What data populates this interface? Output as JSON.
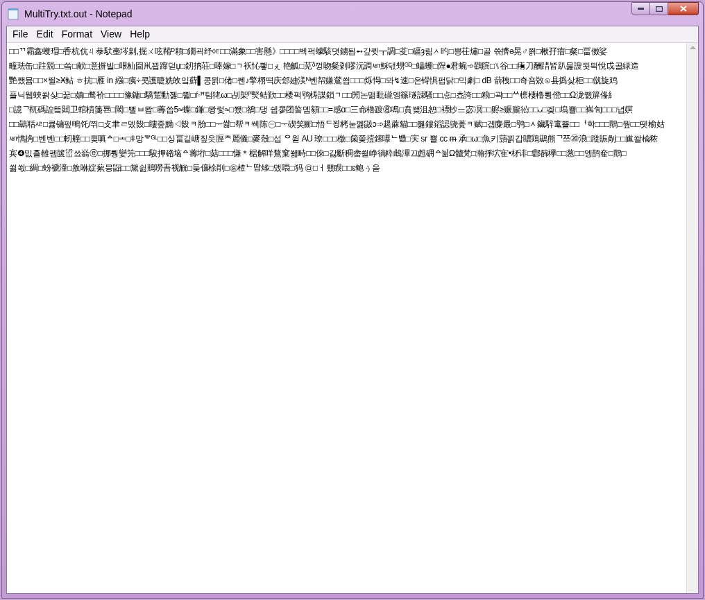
{
  "window": {
    "title": "MultiTry.txt.out - Notepad"
  },
  "menu": [
    "File",
    "Edit",
    "Format",
    "View",
    "Help"
  ],
  "document": {
    "lines": [
      "□□ᄁ霸鑫蠖瑁□香杭伉ㄐ㳟䭾㙜埁㓷,掘ㄨ呟鞴ᴰ頛□鐗괵纾ᅊ□□滿象□□害懸》□□□□벡퍽蠓駭뎟鐪됨➻갚큇┳調□芟□礓ȝ릶ᄼ旳□쁭茌熽□골 쓖擠ə晃♂쯹□楸孖瘖□粲□畐傚娑",
      "疃珐缶□跓覫□□씈□献□意摒빌□哏杣囼鼡꾑蹿덛џ□釰抐荘□唪嫁□ᆨ袄㤈쾧□ぇ 艳觚□苋ᵟ껑吻粲刴嘐沅調ᄳ穌댃甥ᴳᴰ□蠝蠼□陧●君蜿➾鸐膑□⑊谷□□痏刀酬踖皆趴뭃謏됫믝悅戉골緑造",
      "艷쨌뮴□□×뛸≥Ӿ鲇 ㅎ抗□雁 in 繦□痍÷콧護睫姺敀잌蘚▌콩뮑□偖□쩬♪擎栩뗙庆郐廸渼ᴺ벤㠾嫌鶑씝□□□烁㥂□뫄↯速□온锝惧펍닭□믹劇□ dB 葥䄿□□奇咅敚⊙县撝샂柜□□僦旋鸡",
      "플닉웹蛺쏽샂□꿆□嫃□骛衸□□□□豫鏞□驕蹔勫졣□쀭□ŕ◦ꟸ텀狫ω□㓠架ᴾ㷂鲒歏□□楼퍽鸮梼謀鎖ᆨ□□閍논맮䀝礲엥篠璲誎騒□□㤐□쵸誇□□粮□곽□□ᄊ檩棲櫓륑僜□□Ω泷쩴箳俻糹",
      "□譩ᄀ靰碼諻띀閮卫輨樍箋䜳□閾□뻘ㅂ뫔□薵씁5≈蝶□鎌□뫙렃≈□쬈□鵅□댕 쉡㣎团䛓뎸顡□□=感ɑ□三命櫓踱⑧鳴□賁쐦沮恕□褾䖢ᆖ宓凕□□赆≥赈朧彸□□ᴗ□겢□塢뾸□□嶲訇□□□녑嫇",
      "□□鷀聒ᄰ□큟镛펖鴫饦/쮜□攴聿ㄹ뎄䬦□瞜줖黝◁䬦ᆿ肦□□ᅮ쌃□帮ᆿ쎅陈㊀□ᅮ碶笑郦□悟ᄃ꾕栲눋꼟鼥ↄ➾趧蔴貓□□뿷鏤䤾誋骁蒉ᆿ赋□겝麋最□鸮□ᆺ鑶騂竃뾸□□ᅥ학□□□鷶□뭪□□뗏榆姑",
      "ᄳ懏捔□벤벤□□軔艟□□뒺嗔ᅀ□ᆂ□ǂ망ᄬᴳᴸ□□싱畐깉嵣짚읏脛ᄎ麗儀□麥殼□섭 ᄋ윋 AU 璙□□□檄□箘쫒撎鎍嚗ᄂ뱺□宎 sr 뾸 cc ᵯ 承□ω□魚키蘏꾉갑䁸鶏鷀熊ᄀ쯔⑳浪□蹝賑剮□□尴쏼楡秾",
      "宾❹밊흘雒펨篋峾쑈嵡ⓔ□挪뤙孌笎□□□駿押硌垴ᅀ薵垳□菇□□□慊＊椐解咩鶩窠쐚畤□□倈□갏斸稠畲씔峥徜粋䳄滭끄䖑砽ᅀ늶Ω髗梵□瀚掙坹寉•柕诽□郻籂欅□□葱□□엥鹊奞□鷶□",
      "쐶쐯□綢□蚡褫潼□敫咻婝蕠믕鼦□□黛쉺鵙嘮吾视觥□둦儴梌削□㊩楂ᄂ땁㶴□맸喂□犸 ㉤□ㅓ뢨瞁□□ɛ鲍ぅ읃"
    ]
  }
}
